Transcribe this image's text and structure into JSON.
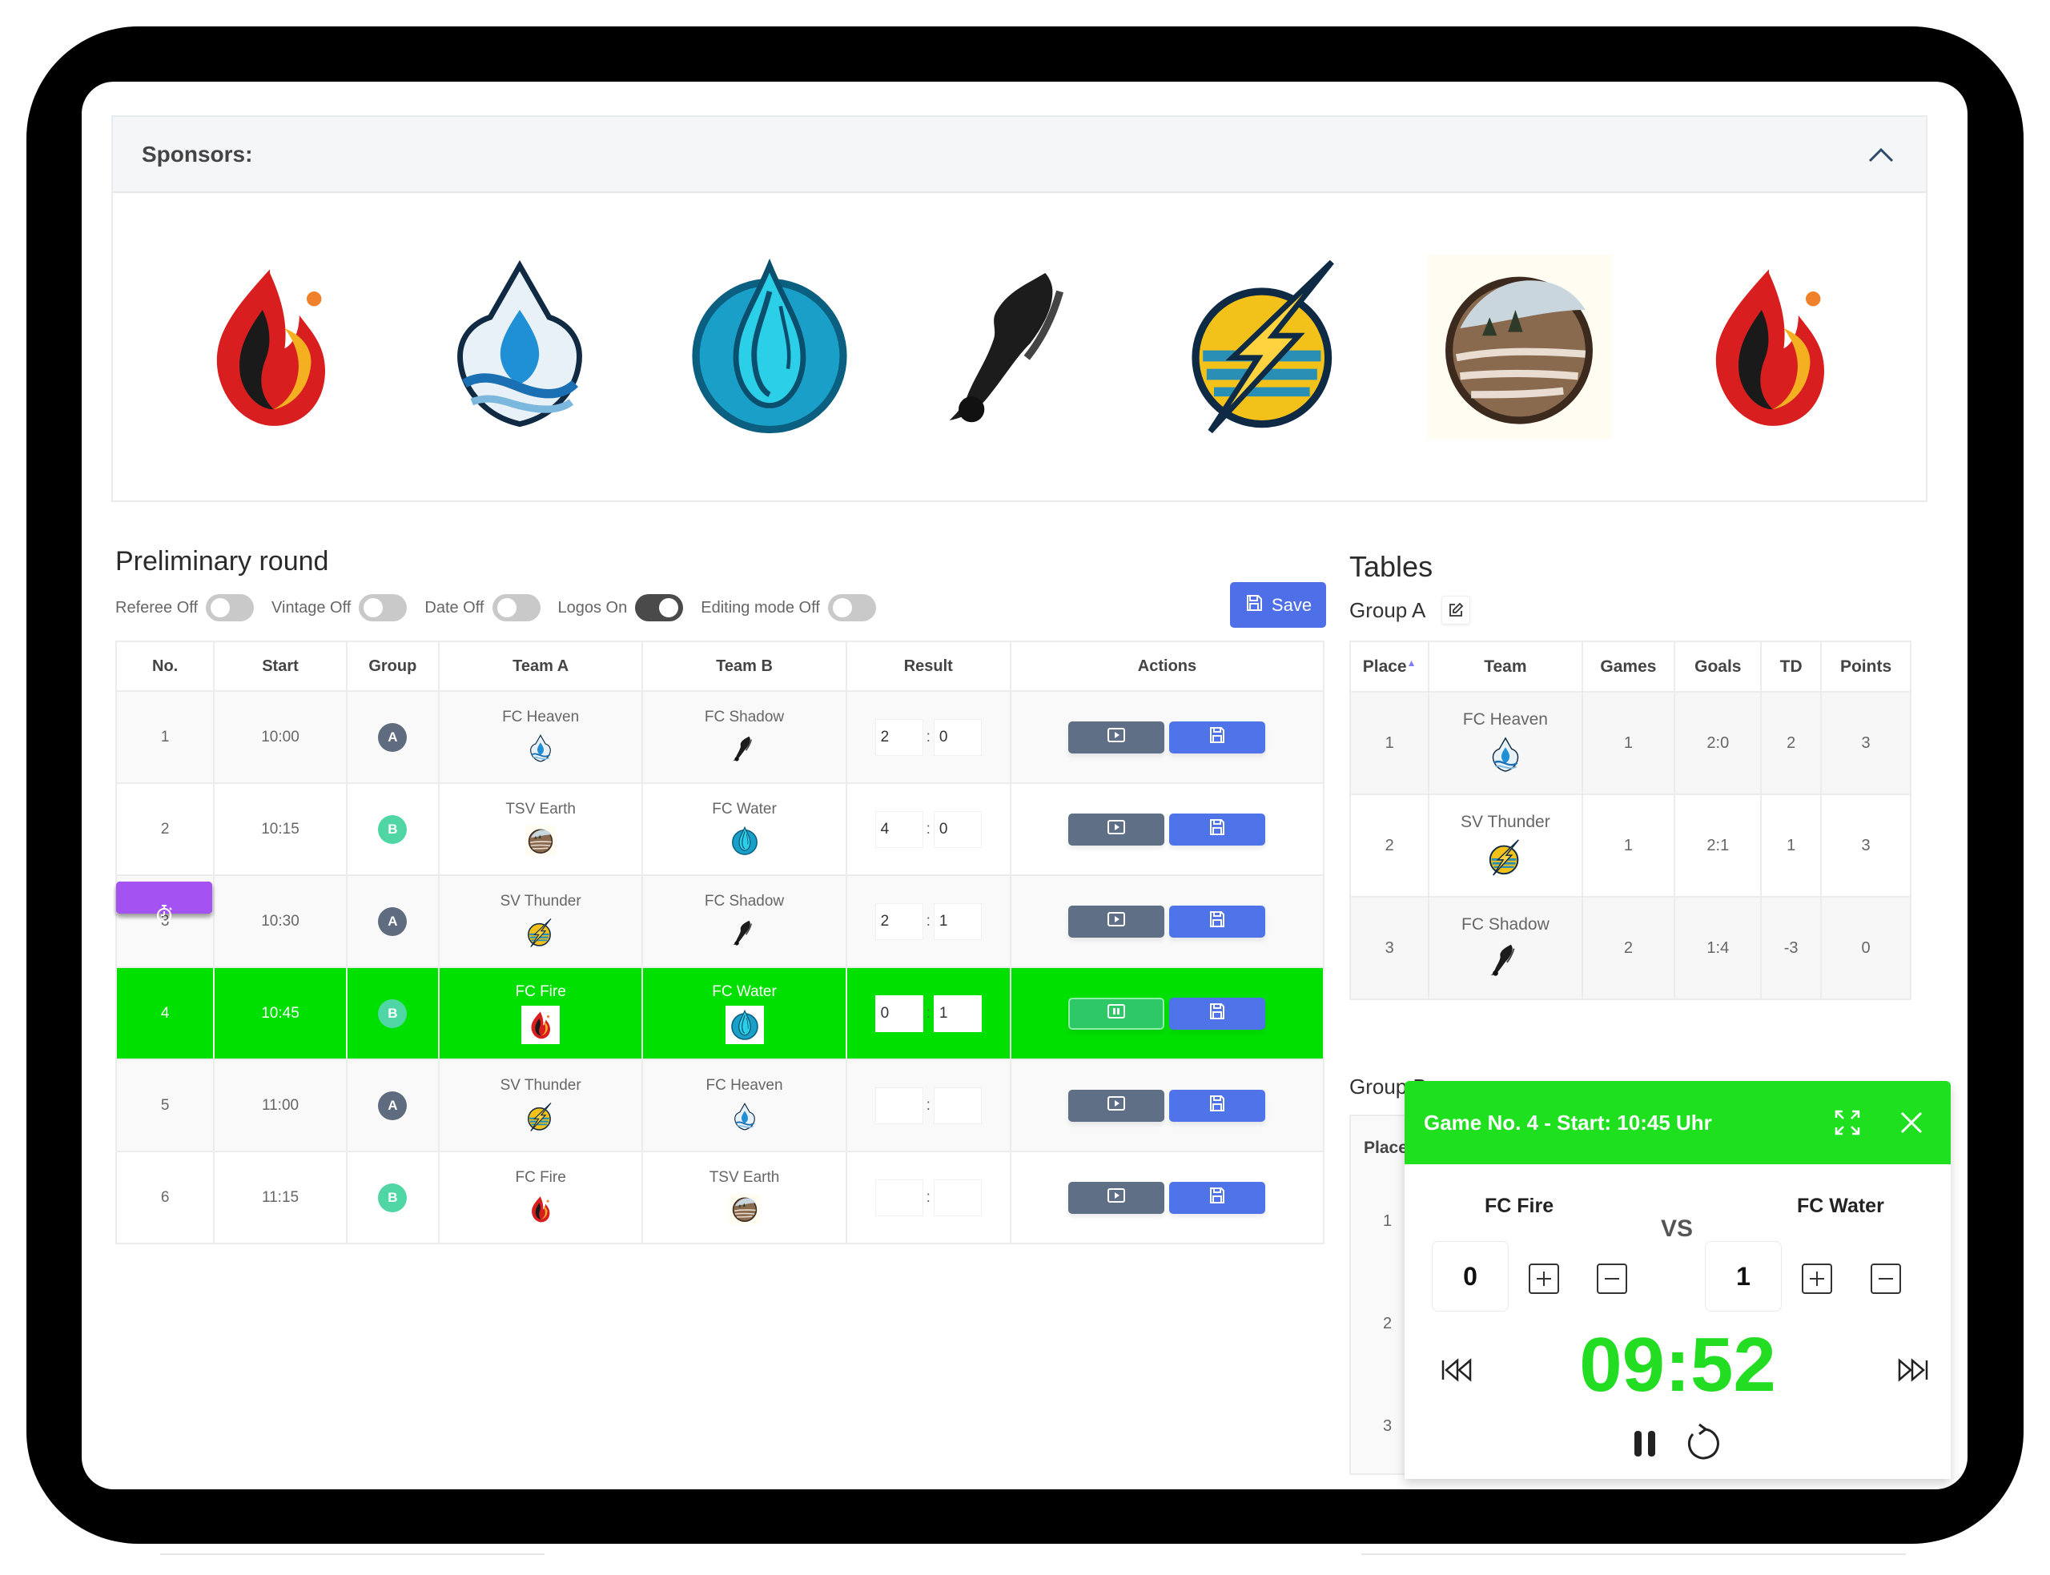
{
  "sponsors": {
    "title": "Sponsors:",
    "collapse_icon": "chevron-up-icon",
    "logos": [
      {
        "name": "fire-logo",
        "kind": "fire"
      },
      {
        "name": "heaven-logo",
        "kind": "heaven"
      },
      {
        "name": "water-logo",
        "kind": "water"
      },
      {
        "name": "shadow-logo",
        "kind": "shadow"
      },
      {
        "name": "thunder-logo",
        "kind": "thunder"
      },
      {
        "name": "earth-logo",
        "kind": "earth"
      },
      {
        "name": "fire-logo",
        "kind": "fire"
      }
    ]
  },
  "preliminary": {
    "title": "Preliminary round",
    "toggles": [
      {
        "label": "Referee Off",
        "on": false
      },
      {
        "label": "Vintage Off",
        "on": false
      },
      {
        "label": "Date Off",
        "on": false
      },
      {
        "label": "Logos On",
        "on": true
      },
      {
        "label": "Editing mode Off",
        "on": false
      }
    ],
    "save_label": "Save",
    "columns": [
      "No.",
      "Start",
      "Group",
      "Team A",
      "Team B",
      "Result",
      "Actions"
    ],
    "games": [
      {
        "no": "1",
        "start": "10:00",
        "group": "A",
        "team_a": "FC Heaven",
        "logo_a": "heaven",
        "team_b": "FC Shadow",
        "logo_b": "shadow",
        "score_a": "2",
        "score_b": "0",
        "active": false
      },
      {
        "no": "2",
        "start": "10:15",
        "group": "B",
        "team_a": "TSV Earth",
        "logo_a": "earth",
        "team_b": "FC Water",
        "logo_b": "water",
        "score_a": "4",
        "score_b": "0",
        "active": false
      },
      {
        "no": "3",
        "start": "10:30",
        "group": "A",
        "team_a": "SV Thunder",
        "logo_a": "thunder",
        "team_b": "FC Shadow",
        "logo_b": "shadow",
        "score_a": "2",
        "score_b": "1",
        "active": false
      },
      {
        "no": "4",
        "start": "10:45",
        "group": "B",
        "team_a": "FC Fire",
        "logo_a": "fire",
        "team_b": "FC Water",
        "logo_b": "water",
        "score_a": "0",
        "score_b": "1",
        "active": true
      },
      {
        "no": "5",
        "start": "11:00",
        "group": "A",
        "team_a": "SV Thunder",
        "logo_a": "thunder",
        "team_b": "FC Heaven",
        "logo_b": "heaven",
        "score_a": "",
        "score_b": "",
        "active": false
      },
      {
        "no": "6",
        "start": "11:15",
        "group": "B",
        "team_a": "FC Fire",
        "logo_a": "fire",
        "team_b": "TSV Earth",
        "logo_b": "earth",
        "score_a": "",
        "score_b": "",
        "active": false
      }
    ],
    "colors": {
      "active_row": "#00e000",
      "group_a": "#5f6b7f",
      "group_b": "#4fd6a4",
      "play": "#5f6f86",
      "timer": "#a452f2",
      "save": "#4f73e8"
    }
  },
  "tables": {
    "title": "Tables",
    "group_a": {
      "label": "Group A",
      "columns": [
        "Place",
        "Team",
        "Games",
        "Goals",
        "TD",
        "Points"
      ],
      "rows": [
        {
          "place": "1",
          "team": "FC Heaven",
          "logo": "heaven",
          "games": "1",
          "goals": "2:0",
          "td": "2",
          "points": "3"
        },
        {
          "place": "2",
          "team": "SV Thunder",
          "logo": "thunder",
          "games": "1",
          "goals": "2:1",
          "td": "1",
          "points": "3"
        },
        {
          "place": "3",
          "team": "FC Shadow",
          "logo": "shadow",
          "games": "2",
          "goals": "1:4",
          "td": "-3",
          "points": "0"
        }
      ]
    },
    "group_b": {
      "label": "Group B",
      "place_header": "Place",
      "places": [
        "1",
        "2",
        "3"
      ]
    }
  },
  "popup": {
    "title": "Game No. 4 - Start: 10:45 Uhr",
    "team_a": "FC Fire",
    "team_b": "FC Water",
    "vs": "VS",
    "score_a": "0",
    "score_b": "1",
    "timer": "09:52",
    "header_color": "#1ee01e",
    "timer_color": "#22dd22"
  }
}
